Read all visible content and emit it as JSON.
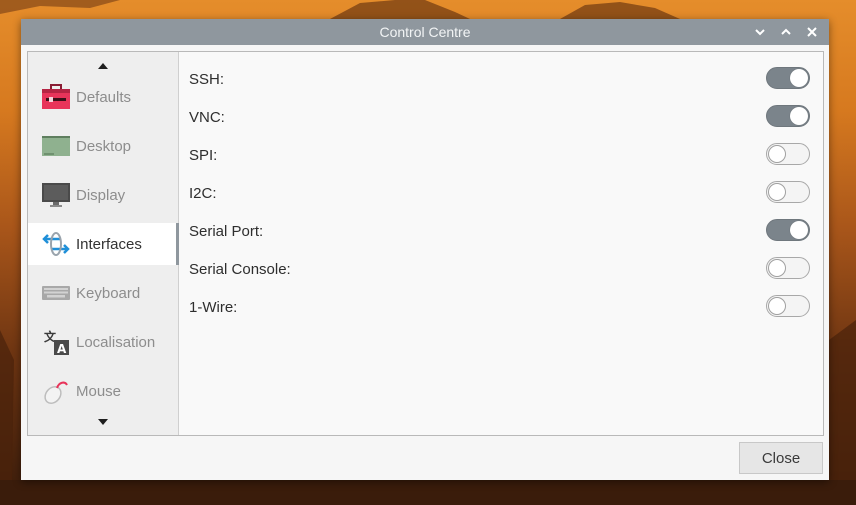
{
  "window": {
    "title": "Control Centre"
  },
  "title_controls": [
    {
      "name": "minimize",
      "icon": "chevron-down-icon"
    },
    {
      "name": "maximize",
      "icon": "chevron-up-icon"
    },
    {
      "name": "close",
      "icon": "close-icon"
    }
  ],
  "sidebar": {
    "items": [
      {
        "label": "Defaults",
        "icon": "toolbox-icon",
        "active": false
      },
      {
        "label": "Desktop",
        "icon": "desktop-icon",
        "active": false
      },
      {
        "label": "Display",
        "icon": "monitor-icon",
        "active": false
      },
      {
        "label": "Interfaces",
        "icon": "interfaces-icon",
        "active": true
      },
      {
        "label": "Keyboard",
        "icon": "keyboard-icon",
        "active": false
      },
      {
        "label": "Localisation",
        "icon": "translate-icon",
        "active": false
      },
      {
        "label": "Mouse",
        "icon": "mouse-icon",
        "active": false
      }
    ]
  },
  "interfaces": [
    {
      "label": "SSH:",
      "enabled": true
    },
    {
      "label": "VNC:",
      "enabled": true
    },
    {
      "label": "SPI:",
      "enabled": false
    },
    {
      "label": "I2C:",
      "enabled": false
    },
    {
      "label": "Serial Port:",
      "enabled": true
    },
    {
      "label": "Serial Console:",
      "enabled": false
    },
    {
      "label": "1-Wire:",
      "enabled": false
    }
  ],
  "footer": {
    "close_label": "Close"
  },
  "colors": {
    "titlebar": "#8f979e",
    "toggle_on": "#7b848b",
    "defaults_icon": "#e8345a",
    "desktop_icon": "#8fb18f",
    "interfaces_icon": "#1f8fd8"
  }
}
